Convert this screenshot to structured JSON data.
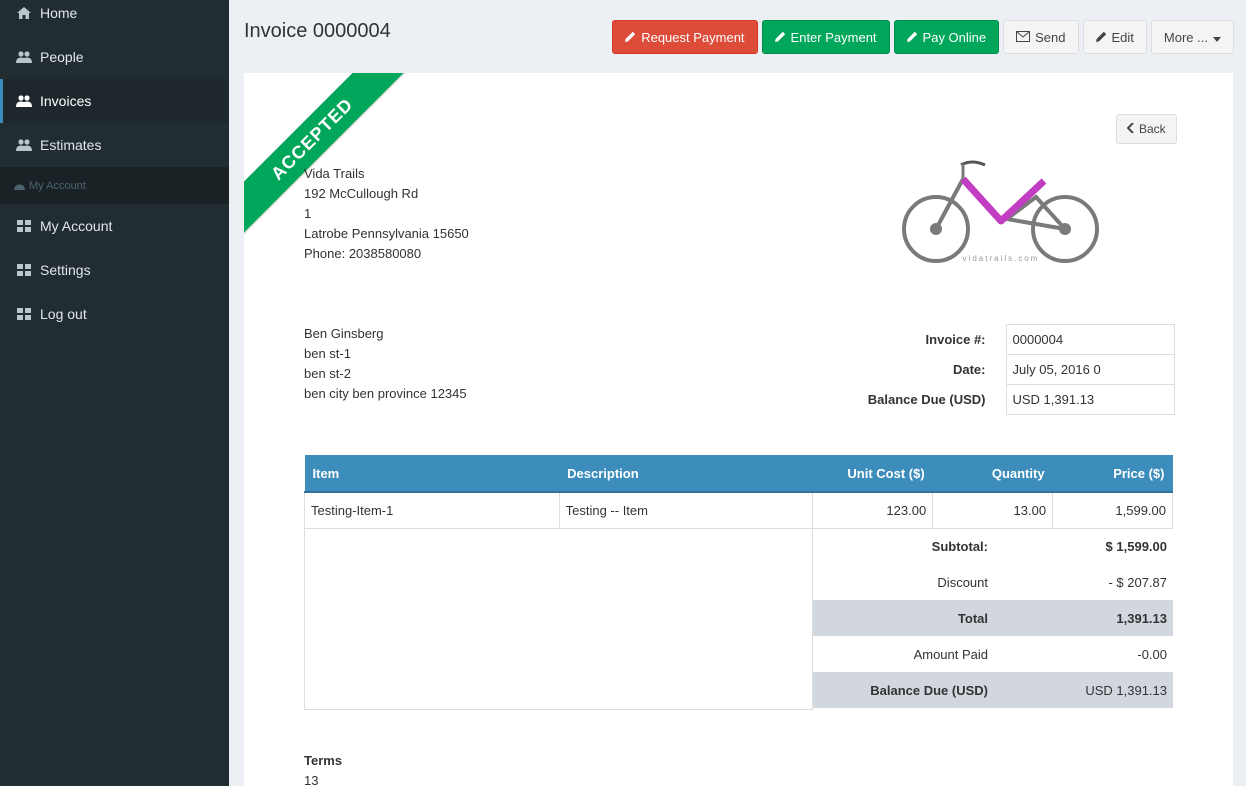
{
  "sidebar": {
    "items": [
      {
        "label": "Home",
        "icon": "home-icon"
      },
      {
        "label": "People",
        "icon": "users-icon"
      },
      {
        "label": "Invoices",
        "icon": "users-icon"
      },
      {
        "label": "Estimates",
        "icon": "users-icon"
      }
    ],
    "header": {
      "label": "My Account",
      "icon": "dashboard-icon"
    },
    "account_items": [
      {
        "label": "My Account",
        "icon": "grid-icon"
      },
      {
        "label": "Settings",
        "icon": "grid-icon"
      },
      {
        "label": "Log out",
        "icon": "grid-icon"
      }
    ]
  },
  "page": {
    "title": "Invoice 0000004"
  },
  "toolbar": {
    "request_payment": "Request Payment",
    "enter_payment": "Enter Payment",
    "pay_online": "Pay Online",
    "send": "Send",
    "edit": "Edit",
    "more": "More ..."
  },
  "status_ribbon": "ACCEPTED",
  "back_label": "Back",
  "company": {
    "name": "Vida Trails",
    "address1": "192 McCullough Rd",
    "address2": "1",
    "city_line": "Latrobe Pennsylvania 15650",
    "phone": "Phone: 2038580080",
    "logo_text": "vidatrails.com"
  },
  "client": {
    "name": "Ben Ginsberg",
    "address1": "ben st-1",
    "address2": "ben st-2",
    "city_line": "ben city ben province 12345"
  },
  "meta": {
    "invoice_label": "Invoice #:",
    "invoice_value": "0000004",
    "date_label": "Date:",
    "date_value": "July 05, 2016 0",
    "balance_label": "Balance Due (USD)",
    "balance_value": "USD 1,391.13"
  },
  "items_table": {
    "headers": {
      "item": "Item",
      "description": "Description",
      "unit_cost": "Unit Cost ($)",
      "quantity": "Quantity",
      "price": "Price ($)"
    },
    "rows": [
      {
        "item": "Testing-Item-1",
        "description": "Testing -- Item",
        "unit_cost": "123.00",
        "quantity": "13.00",
        "price": "1,599.00"
      }
    ]
  },
  "totals": {
    "subtotal_label": "Subtotal:",
    "subtotal_value": "$ 1,599.00",
    "discount_label": "Discount",
    "discount_value": "- $ 207.87",
    "total_label": "Total",
    "total_value": "1,391.13",
    "paid_label": "Amount Paid",
    "paid_value": "-0.00",
    "balance_label": "Balance Due (USD)",
    "balance_value": "USD 1,391.13"
  },
  "terms": {
    "label": "Terms",
    "value": "13"
  },
  "colors": {
    "sidebar_bg": "#222d32",
    "accent_blue": "#3c8dbc",
    "danger": "#dd4b39",
    "success": "#00a65a",
    "logo_magenta": "#c13ec3"
  }
}
